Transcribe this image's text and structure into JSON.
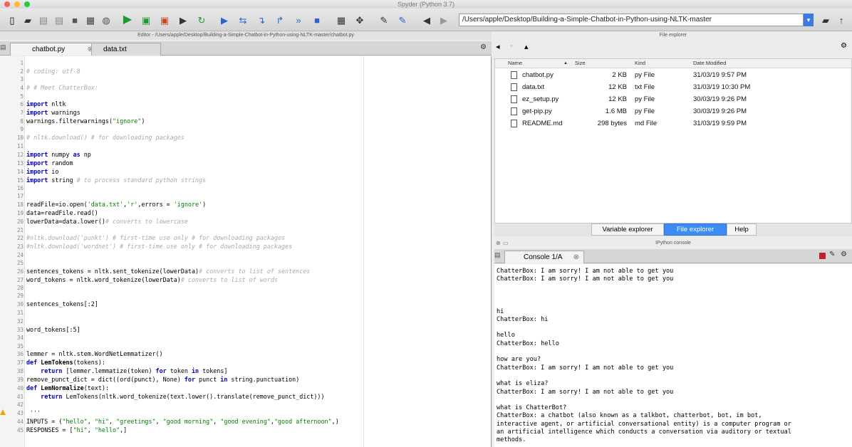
{
  "window": {
    "title": "Spyder (Python 3.7)"
  },
  "toolbar": {
    "icons": [
      "new-file",
      "open-file",
      "save-file",
      "save-all",
      "stop",
      "preferences",
      "run",
      "run-cell",
      "run-cell-advance",
      "run-selection",
      "re-run",
      "debug",
      "step",
      "step-into",
      "step-return",
      "continue",
      "stop-debug",
      "maximize-pane",
      "fullscreen",
      "tools",
      "python-path",
      "back",
      "forward",
      "up"
    ],
    "working_directory": "/Users/apple/Desktop/Building-a-Simple-Chatbot-in-Python-using-NLTK-master"
  },
  "editor": {
    "title": "Editor - /Users/apple/Desktop/Building-a-Simple-Chatbot-in-Python-using-NLTK-master/chatbot.py",
    "tabs": [
      "chatbot.py",
      "data.txt"
    ],
    "line_numbers": [
      "1",
      "2",
      "3",
      "4",
      "5",
      "6",
      "7",
      "8",
      "9",
      "10",
      "11",
      "12",
      "13",
      "14",
      "15",
      "16",
      "17",
      "18",
      "19",
      "20",
      "21",
      "22",
      "23",
      "24",
      "25",
      "26",
      "27",
      "28",
      "29",
      "30",
      "31",
      "32",
      "33",
      "34",
      "35",
      "36",
      "37",
      "38",
      "39",
      "40",
      "41",
      "42",
      "43",
      "44",
      "45"
    ]
  },
  "file_explorer": {
    "title": "File explorer",
    "columns": [
      "Name",
      "Size",
      "Kind",
      "Date Modified"
    ],
    "files": [
      {
        "name": "chatbot.py",
        "size": "2 KB",
        "kind": "py File",
        "date": "31/03/19 9:57 PM"
      },
      {
        "name": "data.txt",
        "size": "12 KB",
        "kind": "txt File",
        "date": "31/03/19 10:30 PM"
      },
      {
        "name": "ez_setup.py",
        "size": "12 KB",
        "kind": "py File",
        "date": "30/03/19 9:26 PM"
      },
      {
        "name": "get-pip.py",
        "size": "1.6 MB",
        "kind": "py File",
        "date": "30/03/19 9:26 PM"
      },
      {
        "name": "README.md",
        "size": "298 bytes",
        "kind": "md File",
        "date": "31/03/19 9:59 PM"
      }
    ],
    "pane_tabs": [
      "Variable explorer",
      "File explorer",
      "Help"
    ]
  },
  "console": {
    "title": "IPython console",
    "tab": "Console 1/A",
    "lines": [
      "ChatterBox: I am sorry! I am not able to get you",
      "ChatterBox: I am sorry! I am not able to get you",
      "",
      "",
      "",
      "hi",
      "ChatterBox: hi",
      "",
      "hello",
      "ChatterBox: hello",
      "",
      "how are you?",
      "ChatterBox: I am sorry! I am not able to get you",
      "",
      "what is eliza?",
      "ChatterBox: I am sorry! I am not able to get you",
      "",
      "what is ChatterBot?",
      "ChatterBox: a chatbot (also known as a talkbot, chatterbot, bot, im bot,",
      "interactive agent, or artificial conversational entity) is a computer program or",
      "an artificial intelligence which conducts a conversation via auditory or textual",
      "methods."
    ]
  },
  "colors": {
    "keyword": "#0000bb",
    "string": "#008000",
    "comment": "#aaaaaa",
    "selected_tab": "#3b8cf5"
  }
}
